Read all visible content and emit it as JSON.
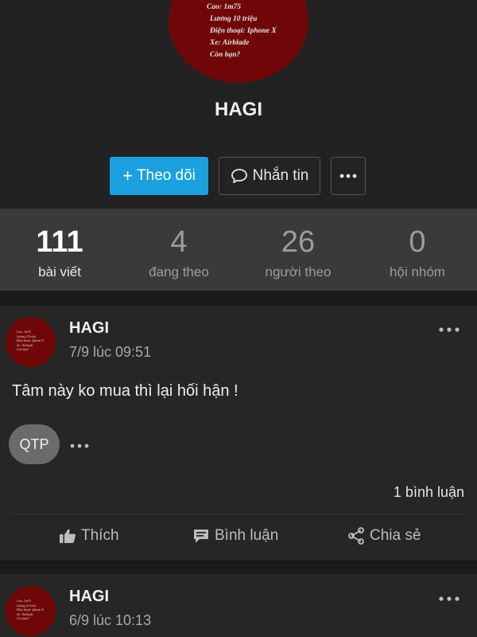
{
  "profile": {
    "name": "HAGI",
    "avatar_text_lines": [
      "Cao: 1m75",
      "Lương 10 triệu",
      "Điện thoại: Iphone X",
      "Xe: Airblade",
      "Còn bạn?"
    ]
  },
  "actions": {
    "follow_label": "Theo dõi",
    "follow_prefix": "+",
    "message_label": "Nhắn tin"
  },
  "stats": [
    {
      "value": "111",
      "label": "bài viết"
    },
    {
      "value": "4",
      "label": "đang theo"
    },
    {
      "value": "26",
      "label": "người theo"
    },
    {
      "value": "0",
      "label": "hội nhóm"
    }
  ],
  "posts": [
    {
      "author": "HAGI",
      "time": "7/9 lúc 09:51",
      "text": "Tâm này ko mua thì lại hối hận !",
      "chip": "QTP",
      "comment_count": "1 bình luận"
    },
    {
      "author": "HAGI",
      "time": "6/9 lúc 10:13"
    }
  ],
  "post_actions": {
    "like": "Thích",
    "comment": "Bình luận",
    "share": "Chia sẻ"
  },
  "colors": {
    "accent": "#1ba1e0",
    "background": "#1b1b1b",
    "card": "#262626",
    "stats_bar": "#3a3a3a",
    "avatar": "#6f0709"
  }
}
